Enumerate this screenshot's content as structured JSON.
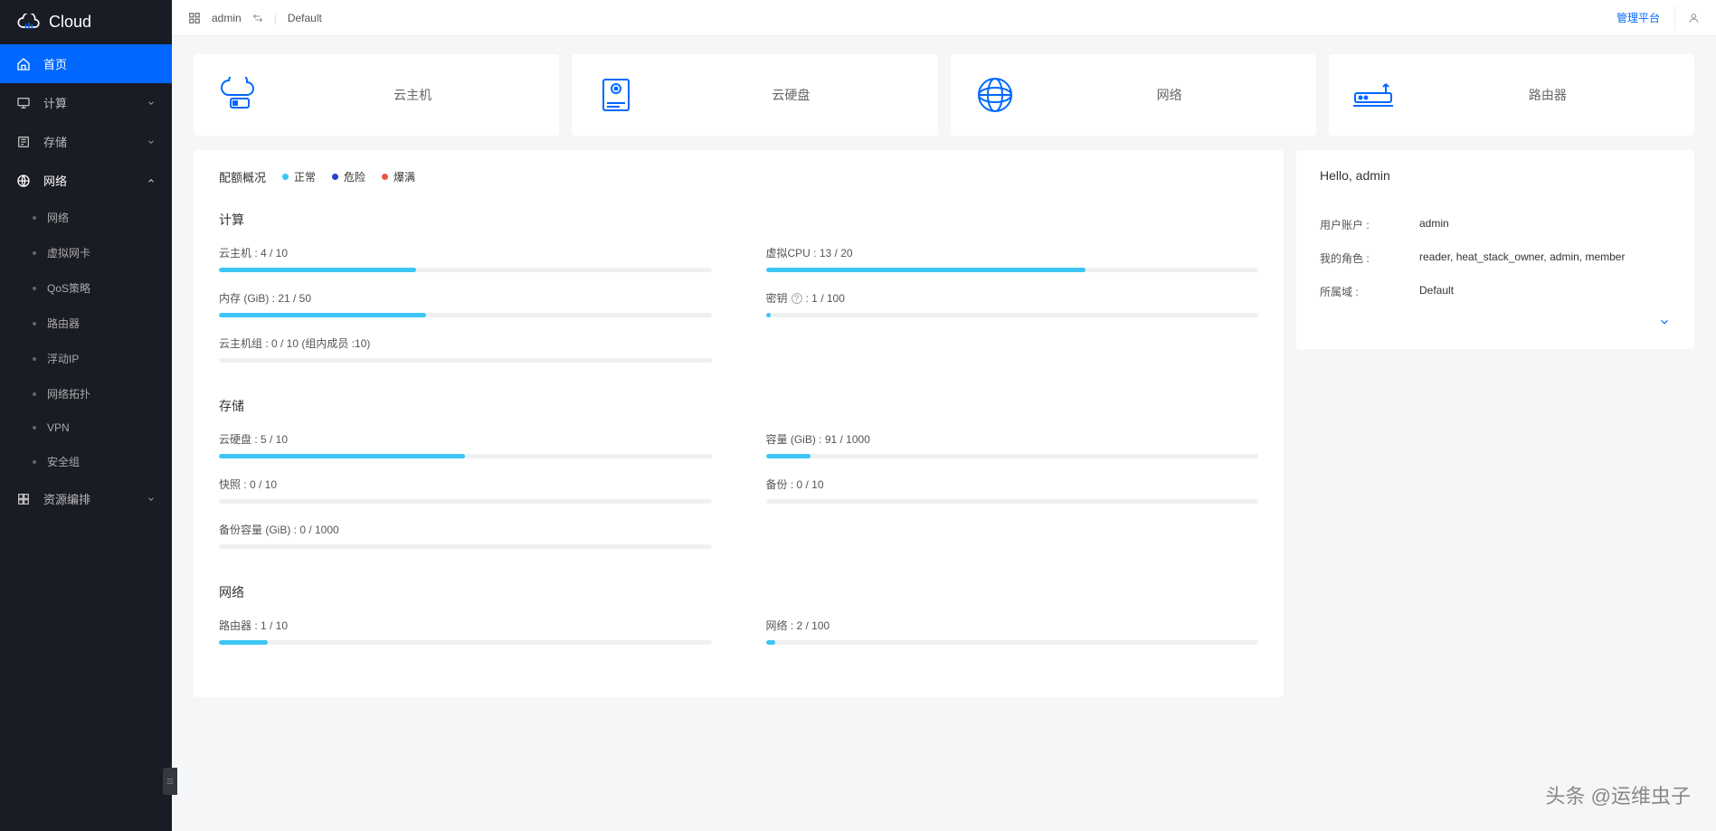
{
  "brand": "Cloud",
  "topbar": {
    "user": "admin",
    "domain": "Default",
    "manage_link": "管理平台"
  },
  "sidebar": {
    "home": "首页",
    "compute": "计算",
    "storage": "存储",
    "network": "网络",
    "orchestration": "资源编排",
    "network_sub": {
      "network": "网络",
      "vnic": "虚拟网卡",
      "qos": "QoS策略",
      "router": "路由器",
      "floating_ip": "浮动IP",
      "topology": "网络拓扑",
      "vpn": "VPN",
      "security_group": "安全组"
    }
  },
  "cards": {
    "instance": "云主机",
    "volume": "云硬盘",
    "network": "网络",
    "router": "路由器"
  },
  "quota": {
    "title": "配额概况",
    "legend": {
      "normal": "正常",
      "danger": "危险",
      "full": "爆满"
    },
    "compute": {
      "title": "计算",
      "items": [
        {
          "label": "云主机 : 4 / 10",
          "pct": 40
        },
        {
          "label": "虚拟CPU : 13 / 20",
          "pct": 65
        },
        {
          "label": "内存 (GiB) : 21 / 50",
          "pct": 42
        },
        {
          "label": "密钥",
          "suffix": " : 1 / 100",
          "pct": 1,
          "help": true
        },
        {
          "label": "云主机组 : 0 / 10 (组内成员 :10)",
          "pct": 0
        }
      ]
    },
    "storage": {
      "title": "存储",
      "items": [
        {
          "label": "云硬盘 : 5 / 10",
          "pct": 50
        },
        {
          "label": "容量 (GiB) : 91 / 1000",
          "pct": 9
        },
        {
          "label": "快照 : 0 / 10",
          "pct": 0
        },
        {
          "label": "备份 : 0 / 10",
          "pct": 0
        },
        {
          "label": "备份容量 (GiB) : 0 / 1000",
          "pct": 0
        }
      ]
    },
    "network": {
      "title": "网络",
      "items": [
        {
          "label": "路由器 : 1 / 10",
          "pct": 10
        },
        {
          "label": "网络 : 2 / 100",
          "pct": 2
        }
      ]
    }
  },
  "user_panel": {
    "hello": "Hello, admin",
    "account_k": "用户账户 :",
    "account_v": "admin",
    "roles_k": "我的角色 :",
    "roles_v": "reader, heat_stack_owner, admin, member",
    "domain_k": "所属域 :",
    "domain_v": "Default"
  },
  "watermark": "头条 @运维虫子",
  "colors": {
    "normal": "#3dc5f5",
    "danger": "#2a3fcf",
    "full": "#e9573f"
  }
}
